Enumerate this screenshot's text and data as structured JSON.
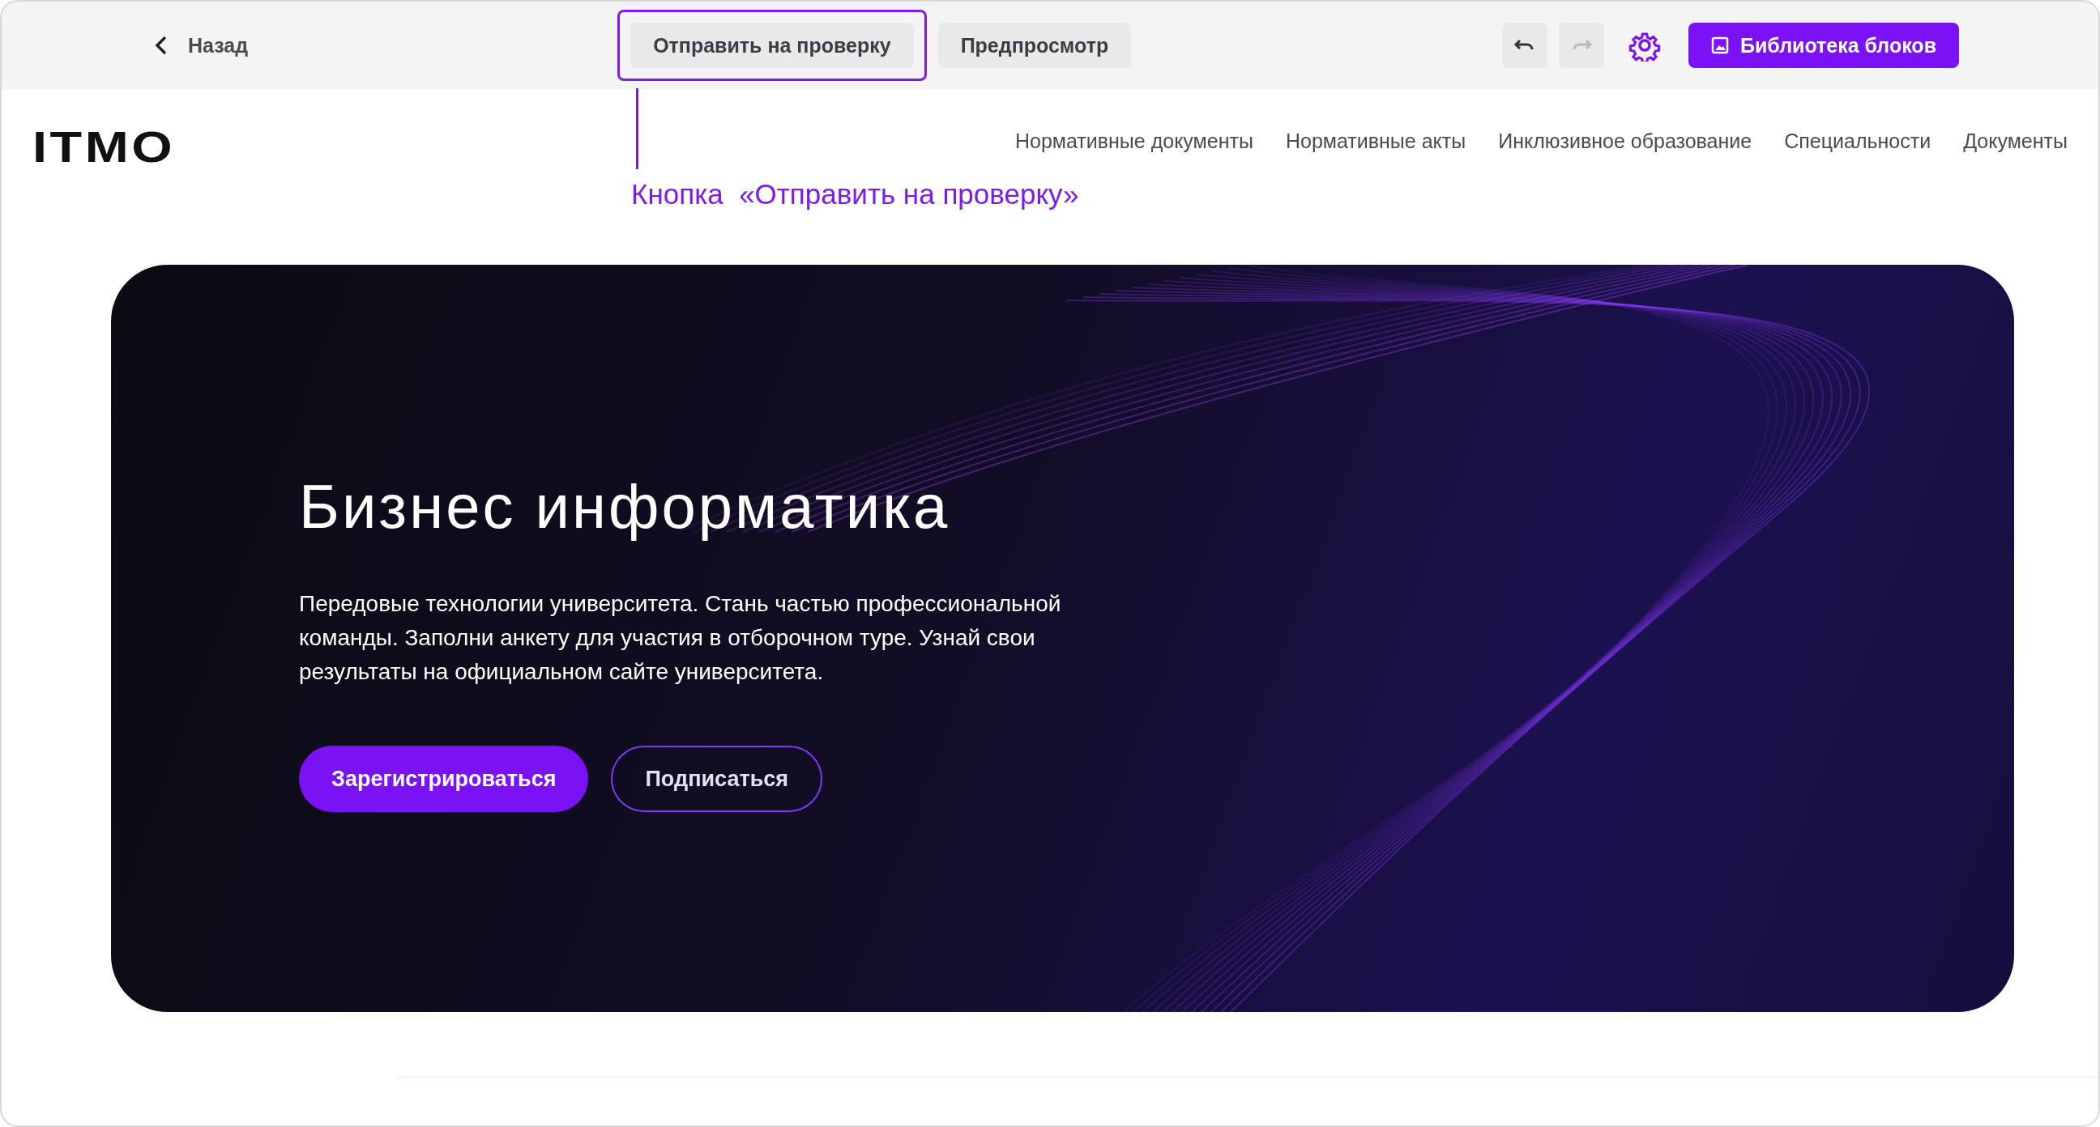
{
  "toolbar": {
    "back": {
      "label": "Назад"
    },
    "actions": [
      {
        "label": "Отправить на проверку",
        "highlighted": true
      },
      {
        "label": "Предпросмотр",
        "highlighted": false
      }
    ],
    "undo": {
      "disabled": false
    },
    "redo": {
      "disabled": true
    },
    "library_button": {
      "label": "Библиотека блоков"
    }
  },
  "annotation": {
    "caption": "Кнопка  «Отправить на проверку»"
  },
  "site": {
    "logo": "ITMO",
    "nav": [
      "Нормативные документы",
      "Нормативные акты",
      "Инклюзивное образование",
      "Специальности",
      "Документы"
    ]
  },
  "hero": {
    "title": "Бизнес информатика",
    "text": "Передовые технологии университета. Стань частью профессиональной команды. Заполни анкету для участия в отборочном туре. Узнай свои результаты на официальном сайте университета.",
    "buttons": [
      {
        "kind": "primary",
        "label": "Зарегистрироваться"
      },
      {
        "kind": "outline",
        "label": "Подписаться"
      }
    ]
  }
}
